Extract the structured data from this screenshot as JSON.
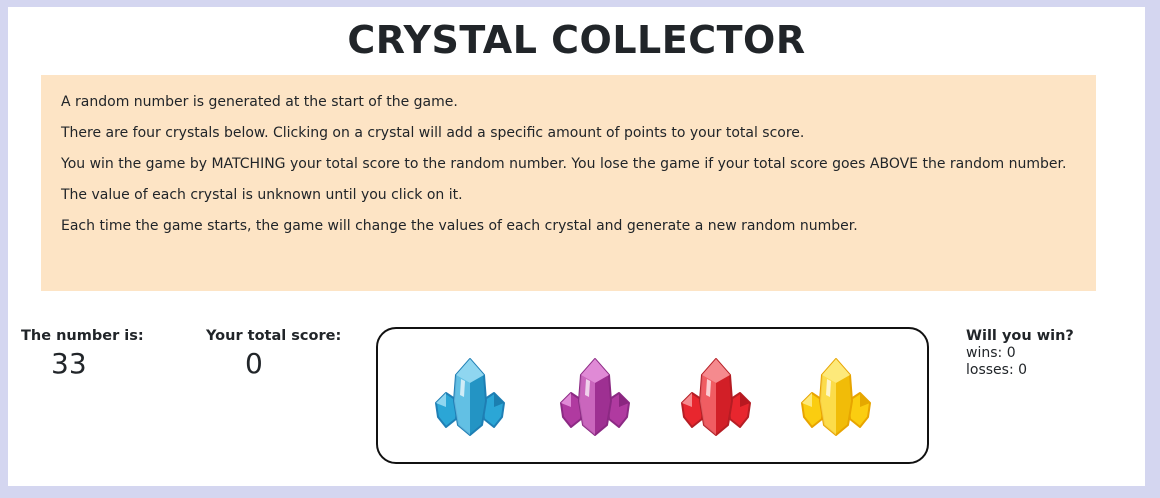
{
  "title": "CRYSTAL COLLECTOR",
  "instructions": [
    "A random number is generated at the start of the game.",
    "There are four crystals below. Clicking on a crystal will add a specific amount of points to your total score.",
    "You win the game by MATCHING your total score to the random number. You lose the game if your total score goes ABOVE the random number.",
    "The value of each crystal is unknown until you click on it.",
    "Each time the game starts, the game will change the values of each crystal and generate a new random number."
  ],
  "target": {
    "label": "The number is:",
    "value": "33"
  },
  "score": {
    "label": "Your total score:",
    "value": "0"
  },
  "crystals": [
    {
      "name": "blue-crystal",
      "main": "#2ba6d6",
      "light": "#8fd6f0",
      "dark": "#1b7fb0",
      "stroke": "#1f7fb5"
    },
    {
      "name": "purple-crystal",
      "main": "#b03aa0",
      "light": "#e08ad6",
      "dark": "#8a2580",
      "stroke": "#8c2a84"
    },
    {
      "name": "red-crystal",
      "main": "#e8262e",
      "light": "#f58a8e",
      "dark": "#b81820",
      "stroke": "#b51e25"
    },
    {
      "name": "yellow-crystal",
      "main": "#fbcd10",
      "light": "#fde97a",
      "dark": "#e5a800",
      "stroke": "#e8a400"
    }
  ],
  "status": {
    "heading": "Will you win?",
    "wins_label": "wins:",
    "wins": "0",
    "losses_label": "losses:",
    "losses": "0"
  }
}
